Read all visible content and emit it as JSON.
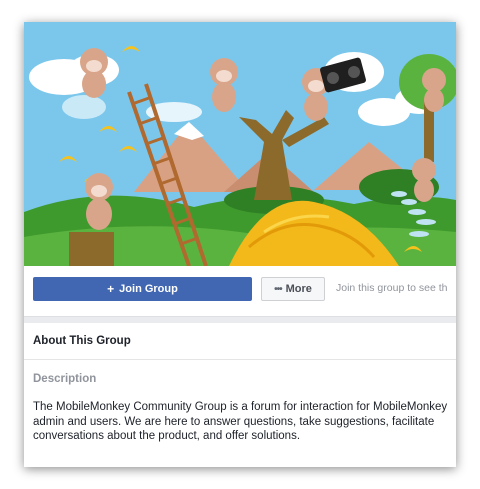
{
  "cover": {
    "description_icons": [
      "monkey",
      "ladder",
      "bananas",
      "boombox",
      "tree",
      "clouds",
      "mountains",
      "path"
    ]
  },
  "actions": {
    "join_label": "Join Group",
    "join_icon": "plus-icon",
    "more_label": "More",
    "more_icon": "ellipsis-icon",
    "join_hint": "Join this group to see th"
  },
  "about": {
    "title": "About This Group",
    "description_label": "Description",
    "description_text": "The MobileMonkey Community Group is a forum for interaction for MobileMonkey admin and users. We are here to answer questions, take suggestions, facilitate conversations about the product, and offer solutions."
  },
  "colors": {
    "brand_button": "#4267b2",
    "sky": "#78c6ea",
    "grass": "#4ea335",
    "bananas": "#f6c21b"
  }
}
